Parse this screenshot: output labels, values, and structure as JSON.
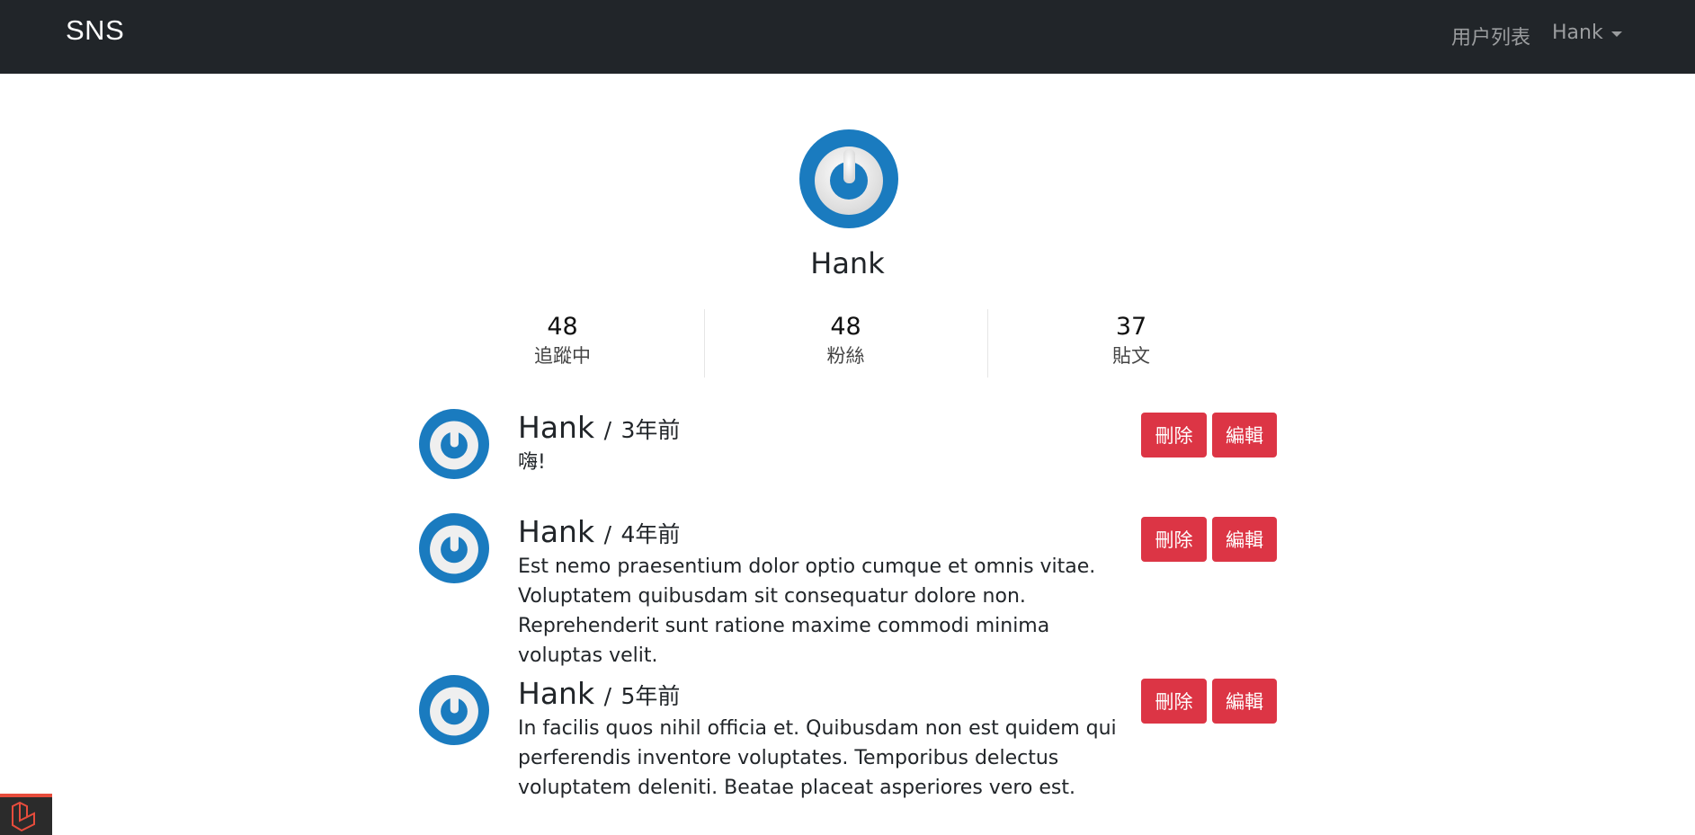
{
  "navbar": {
    "brand": "SNS",
    "users_link": "用户列表",
    "user_menu": "Hank"
  },
  "profile": {
    "name": "Hank",
    "stats": [
      {
        "count": "48",
        "label": "追蹤中"
      },
      {
        "count": "48",
        "label": "粉絲"
      },
      {
        "count": "37",
        "label": "貼文"
      }
    ]
  },
  "posts": [
    {
      "author": "Hank",
      "separator": "/",
      "time": "3年前",
      "content": "嗨!",
      "delete_label": "刪除",
      "edit_label": "編輯"
    },
    {
      "author": "Hank",
      "separator": "/",
      "time": "4年前",
      "content": "Est nemo praesentium dolor optio cumque et omnis vitae. Voluptatem quibusdam sit consequatur dolore non. Reprehenderit sunt ratione maxime commodi minima voluptas velit.",
      "delete_label": "刪除",
      "edit_label": "編輯"
    },
    {
      "author": "Hank",
      "separator": "/",
      "time": "5年前",
      "content": "In facilis quos nihil officia et. Quibusdam non est quidem qui perferendis inventore voluptates. Temporibus delectus voluptatem deleniti. Beatae placeat asperiores vero est.",
      "delete_label": "刪除",
      "edit_label": "編輯"
    }
  ],
  "icons": {
    "avatar": "gravatar-power-icon",
    "caret": "caret-down-icon",
    "debug": "laravel-logo-icon"
  },
  "colors": {
    "navbar_bg": "#212529",
    "danger": "#dc3545",
    "avatar_blue": "#1a7bbf"
  }
}
